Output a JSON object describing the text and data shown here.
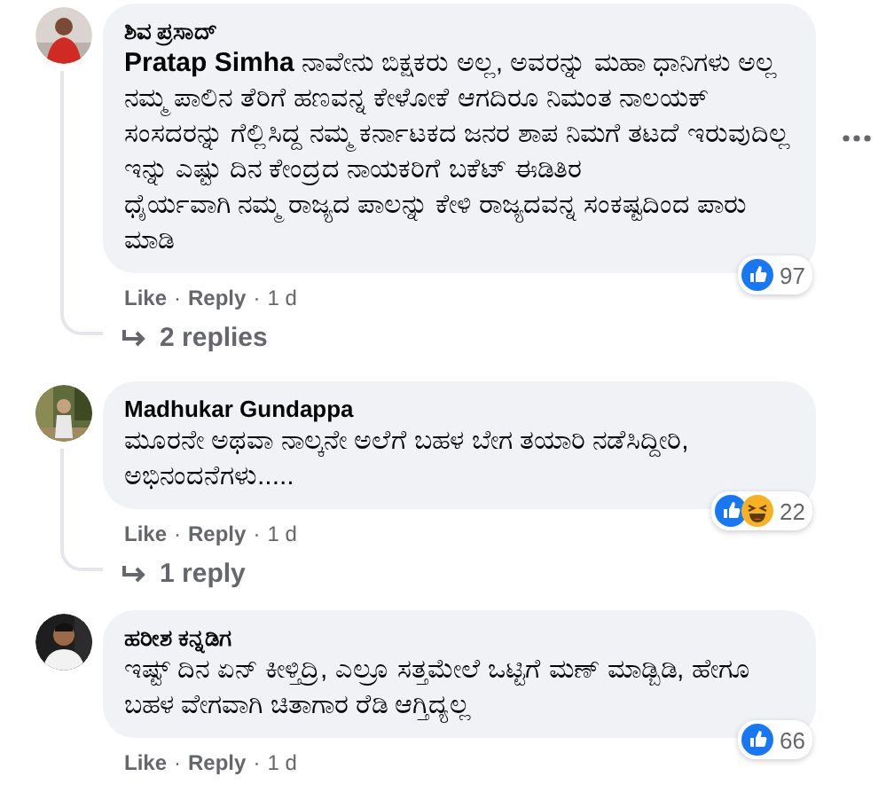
{
  "separator": "·",
  "comments": [
    {
      "author": "ಶಿವ ಪ್ರಸಾದ್",
      "avatar": {
        "kind": "picture"
      },
      "text": "**Pratap Simha** ನಾವೇನು ಬಿಕ್ಷಕರು ಅಲ್ಲ, ಅವರನ್ನು ಮಹಾ ಧಾನಿಗಳು ಅಲ್ಲ\nನಮ್ಮ ಪಾಲಿನ ತೆರಿಗೆ ಹಣವನ್ನ ಕೇಳೋಕೆ ಆಗದಿರೂ ನಿಮಂತ ನಾಲಯಕ್ ಸಂಸದರನ್ನು ಗೆಲ್ಲಿಸಿದ್ದ ನಮ್ಮ ಕರ್ನಾಟಕದ ಜನರ ಶಾಪ ನಿಮಗೆ ತಟದೆ ಇರುವುದಿಲ್ಲ\nಇನ್ನು ಎಷ್ಟು ದಿನ ಕೇಂದ್ರದ ನಾಯಕರಿಗೆ ಬಕೆಟ್ ಈಡಿತಿರ\nಧೈರ್ಯವಾಗಿ ನಮ್ಮ ರಾಜ್ಯದ ಪಾಲನ್ನು ಕೇಳಿ ರಾಜ್ಯದವನ್ನ ಸಂಕಷ್ಟದಿಂದ ಪಾರು ಮಾಡಿ",
      "actions": [
        "Like",
        "Reply"
      ],
      "time": "1 d",
      "reactions": [
        {
          "kind": "like"
        }
      ],
      "reaction_count": "97",
      "replies": "2 replies",
      "more_menu": true
    },
    {
      "author": "Madhukar Gundappa",
      "avatar": {
        "kind": "picture"
      },
      "text": "ಮೂರನೇ ಅಥವಾ ನಾಲ್ಕನೇ ಅಲೆಗೆ ಬಹಳ ಬೇಗ ತಯಾರಿ ನಡೆಸಿದ್ದೀರಿ, ಅಭಿನಂದನೆಗಳು.....",
      "actions": [
        "Like",
        "Reply"
      ],
      "time": "1 d",
      "reactions": [
        {
          "kind": "like"
        },
        {
          "kind": "haha"
        }
      ],
      "reaction_count": "22",
      "replies": "1 reply",
      "more_menu": false
    },
    {
      "author": "ಹರೀಶ ಕನ್ನಡಿಗ",
      "avatar": {
        "kind": "picture"
      },
      "text": "ಇಷ್ಟ್ ದಿನ ಏನ್ ಕೀಳ್ತಿದ್ರಿ, ಎಲ್ರೂ ಸತ್ತಮೇಲೆ ಒಟ್ಟಿಗೆ ಮಣ್ ಮಾಡ್ಬಿಡಿ, ಹೇಗೂ ಬಹಳ ವೇಗವಾಗಿ ಚಿತಾಗಾರ ರೆಡಿ ಆಗ್ತಿದ್ಯಲ್ಲ",
      "actions": [
        "Like",
        "Reply"
      ],
      "time": "1 d",
      "reactions": [
        {
          "kind": "like"
        }
      ],
      "reaction_count": "66",
      "more_menu": false
    }
  ]
}
